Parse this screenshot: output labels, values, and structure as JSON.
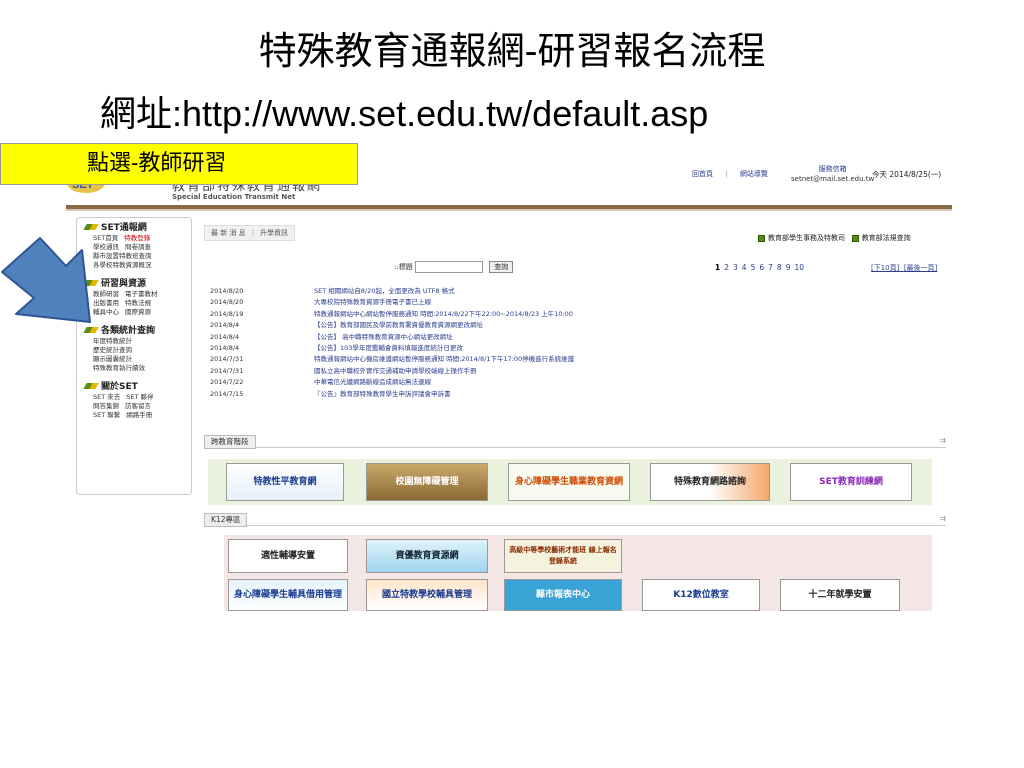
{
  "slide": {
    "title": "特殊教育通報網-研習報名流程",
    "subtitle_prefix": "網址",
    "subtitle_url": ":http://www.set.edu.tw/default.asp",
    "callout": "點選-教師研習"
  },
  "header": {
    "site_name": "教育部特殊教育通報網",
    "site_name_en": "Special Education Transmit Net",
    "home": "回首頁",
    "sitemap": "網站導覽",
    "service_title": "服務信箱",
    "service_email": "setnet@mail.set.edu.tw",
    "today": "今天 2014/8/25(一)"
  },
  "sidebar": {
    "set_title": "SET通報網",
    "set_items": [
      "SET首頁",
      "特教登錄",
      "學校通訊",
      "問卷調查",
      "縣市設置特教班查詢",
      "各學校特教資源概況"
    ],
    "study_title": "研習與資源",
    "study_items": [
      "教師研習",
      "電子書教材",
      "出版書用",
      "特教法規",
      "輔具中心",
      "國際資源"
    ],
    "stats_title": "各類統計查詢",
    "stats_items": [
      "年度特教統計",
      "歷史統計查詢",
      "顯示圖囊統計",
      "特殊教育執行績效"
    ],
    "about_title": "關於SET",
    "about_items": [
      "SET 來去",
      "SET 夥伴",
      "問答集錦",
      "訪客留言",
      "SET 聯繫",
      "網路手冊"
    ]
  },
  "main": {
    "tab_news": "最 新 消 息",
    "tab_study": "升學資訊",
    "link_ministry": "教育部學生事務及特教司",
    "link_law": "教育部法規查詢",
    "search_label": "::標題",
    "search_button": "查詢",
    "pages": [
      "1",
      "2",
      "3",
      "4",
      "5",
      "6",
      "7",
      "8",
      "9",
      "10"
    ],
    "next10": "[下10頁]",
    "last_page": "[最後一頁]",
    "news": [
      {
        "date": "2014/8/20",
        "title": "SET 相關網站自8/20起，全面更改為 UTF8 格式"
      },
      {
        "date": "2014/8/20",
        "title": "大專校院特殊教育資源手冊電子書已上線"
      },
      {
        "date": "2014/8/19",
        "title": "特教通報網站中心網站暫停服務通知 時間:2014/8/22下午22:00~2014/8/23 上午10:00"
      },
      {
        "date": "2014/8/4",
        "title": "【公告】教育部國民及學前教育署資優教育資源網更改網址"
      },
      {
        "date": "2014/8/4",
        "title": "【公告】 高中職特殊教育資源中心網站更改網址"
      },
      {
        "date": "2014/8/4",
        "title": "【公告】103學年度鑑輔會資料填報進度統計日更改"
      },
      {
        "date": "2014/7/31",
        "title": "特教通報網站中心機房維護網站暫停服務通知 時間:2014/8/1下午17:00停機進行系統維護"
      },
      {
        "date": "2014/7/31",
        "title": "國私立高中職校外實作交通補助申請學校端線上操作手冊"
      },
      {
        "date": "2014/7/22",
        "title": "中華電信光纖網路斷線造成網站無法連線"
      },
      {
        "date": "2014/7/15",
        "title": "『公告』教育部特殊教育學生申訴評議會申訴書"
      }
    ],
    "cross_title": "跨教育階段",
    "cross_banners": [
      "特教性平教育網",
      "校園無障礙管理",
      "身心障礙學生職業教育資網",
      "特殊教育網路諮詢",
      "SET教育訓練網"
    ],
    "k12_title": "K12專區",
    "k12_banners": [
      "適性輔導安置",
      "資優教育資源網",
      "高級中等學校藝術才能班 線上報名 登錄系統",
      "身心障礙學生輔具借用管理",
      "國立特教學校輔具管理",
      "縣市報表中心",
      "K12數位教室",
      "十二年就學安置"
    ]
  }
}
